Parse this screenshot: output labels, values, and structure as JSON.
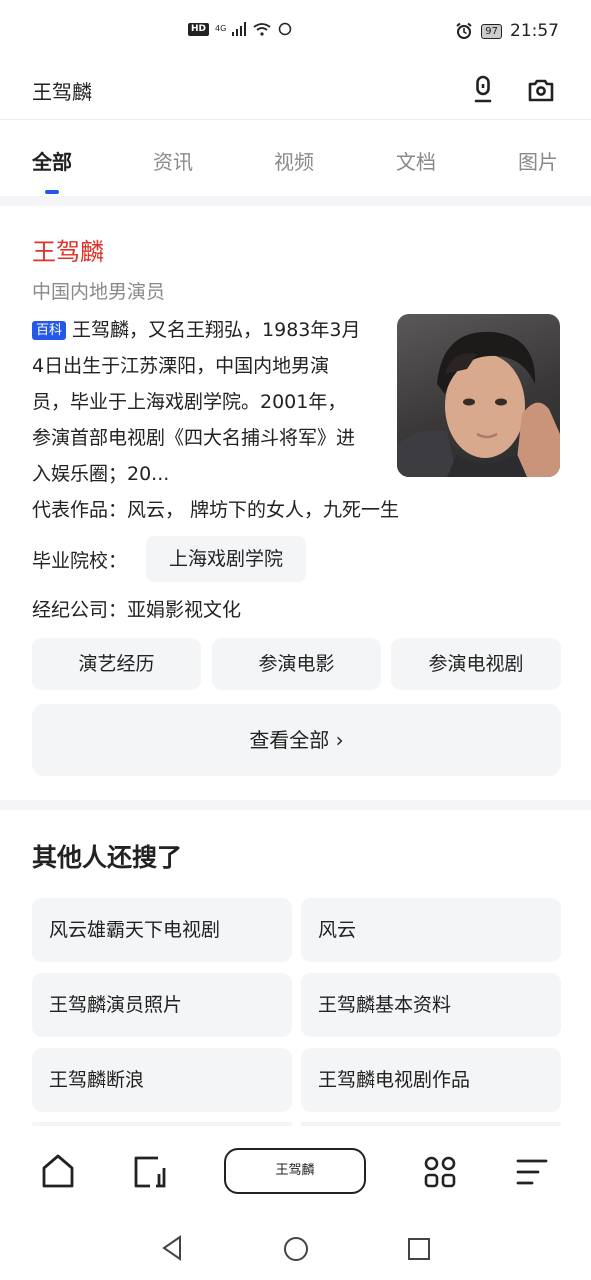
{
  "status_bar": {
    "hd": "HD",
    "network": "4G",
    "battery": "97",
    "time": "21:57"
  },
  "search": {
    "query": "王驾麟"
  },
  "tabs": [
    {
      "label": "全部",
      "active": true
    },
    {
      "label": "资讯",
      "active": false
    },
    {
      "label": "视频",
      "active": false
    },
    {
      "label": "文档",
      "active": false
    },
    {
      "label": "图片",
      "active": false
    }
  ],
  "card": {
    "title": "王驾麟",
    "subtitle": "中国内地男演员",
    "badge": "百科",
    "summary": "王驾麟，又名王翔弘，1983年3月4日出生于江苏溧阳，中国内地男演员，毕业于上海戏剧学院。2001年，参演首部电视剧《四大名捕斗将军》进入娱乐圈；20...",
    "works_label": "代表作品：",
    "works_value": "风云， 牌坊下的女人，九死一生",
    "school_label": "毕业院校：",
    "school_value": "上海戏剧学院",
    "company_label": "经纪公司：",
    "company_value": "亚娟影视文化",
    "buttons": [
      "演艺经历",
      "参演电影",
      "参演电视剧"
    ],
    "view_all": "查看全部 ›"
  },
  "related": {
    "title": "其他人还搜了",
    "items": [
      "风云雄霸天下电视剧",
      "风云",
      "王驾麟演员照片",
      "王驾麟基本资料",
      "王驾麟断浪",
      "王驾麟电视剧作品"
    ]
  },
  "bottom_bar": {
    "pill": "王驾麟",
    "icons": [
      "home-icon",
      "tabs-icon",
      "apps-icon",
      "menu-icon"
    ]
  },
  "colors": {
    "accent": "#2458e8",
    "title_red": "#e03127",
    "chip_bg": "#f4f5f7"
  }
}
